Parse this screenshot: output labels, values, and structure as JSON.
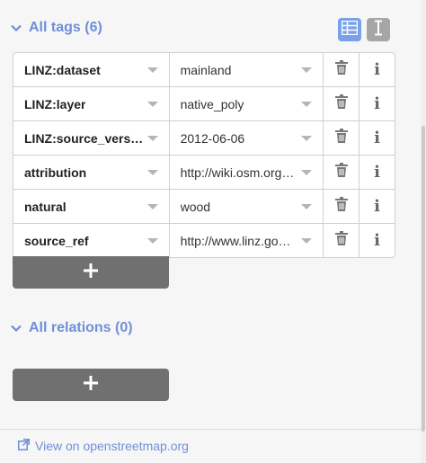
{
  "tags_section": {
    "title": "All tags (6)",
    "tags": [
      {
        "key": "LINZ:dataset",
        "value": "mainland"
      },
      {
        "key": "LINZ:layer",
        "value": "native_poly"
      },
      {
        "key": "LINZ:source_versi…",
        "value": "2012-06-06"
      },
      {
        "key": "attribution",
        "value": "http://wiki.osm.org…"
      },
      {
        "key": "natural",
        "value": "wood"
      },
      {
        "key": "source_ref",
        "value": "http://www.linz.go…"
      }
    ],
    "add_label": "+",
    "info_label": "i"
  },
  "relations_section": {
    "title": "All relations (0)",
    "add_label": "+"
  },
  "footer": {
    "link_text": "View on openstreetmap.org"
  },
  "colors": {
    "accent": "#6f8fd8",
    "list_view_active": "#7aa0e9",
    "text_view_inactive": "#a6a6a6",
    "button_bg": "#707070"
  },
  "icons": {
    "collapse": "chevron-down-icon",
    "list_view": "list-view-icon",
    "text_view": "text-view-icon",
    "delete": "trash-icon",
    "info": "info-icon",
    "external_link": "external-link-icon"
  }
}
